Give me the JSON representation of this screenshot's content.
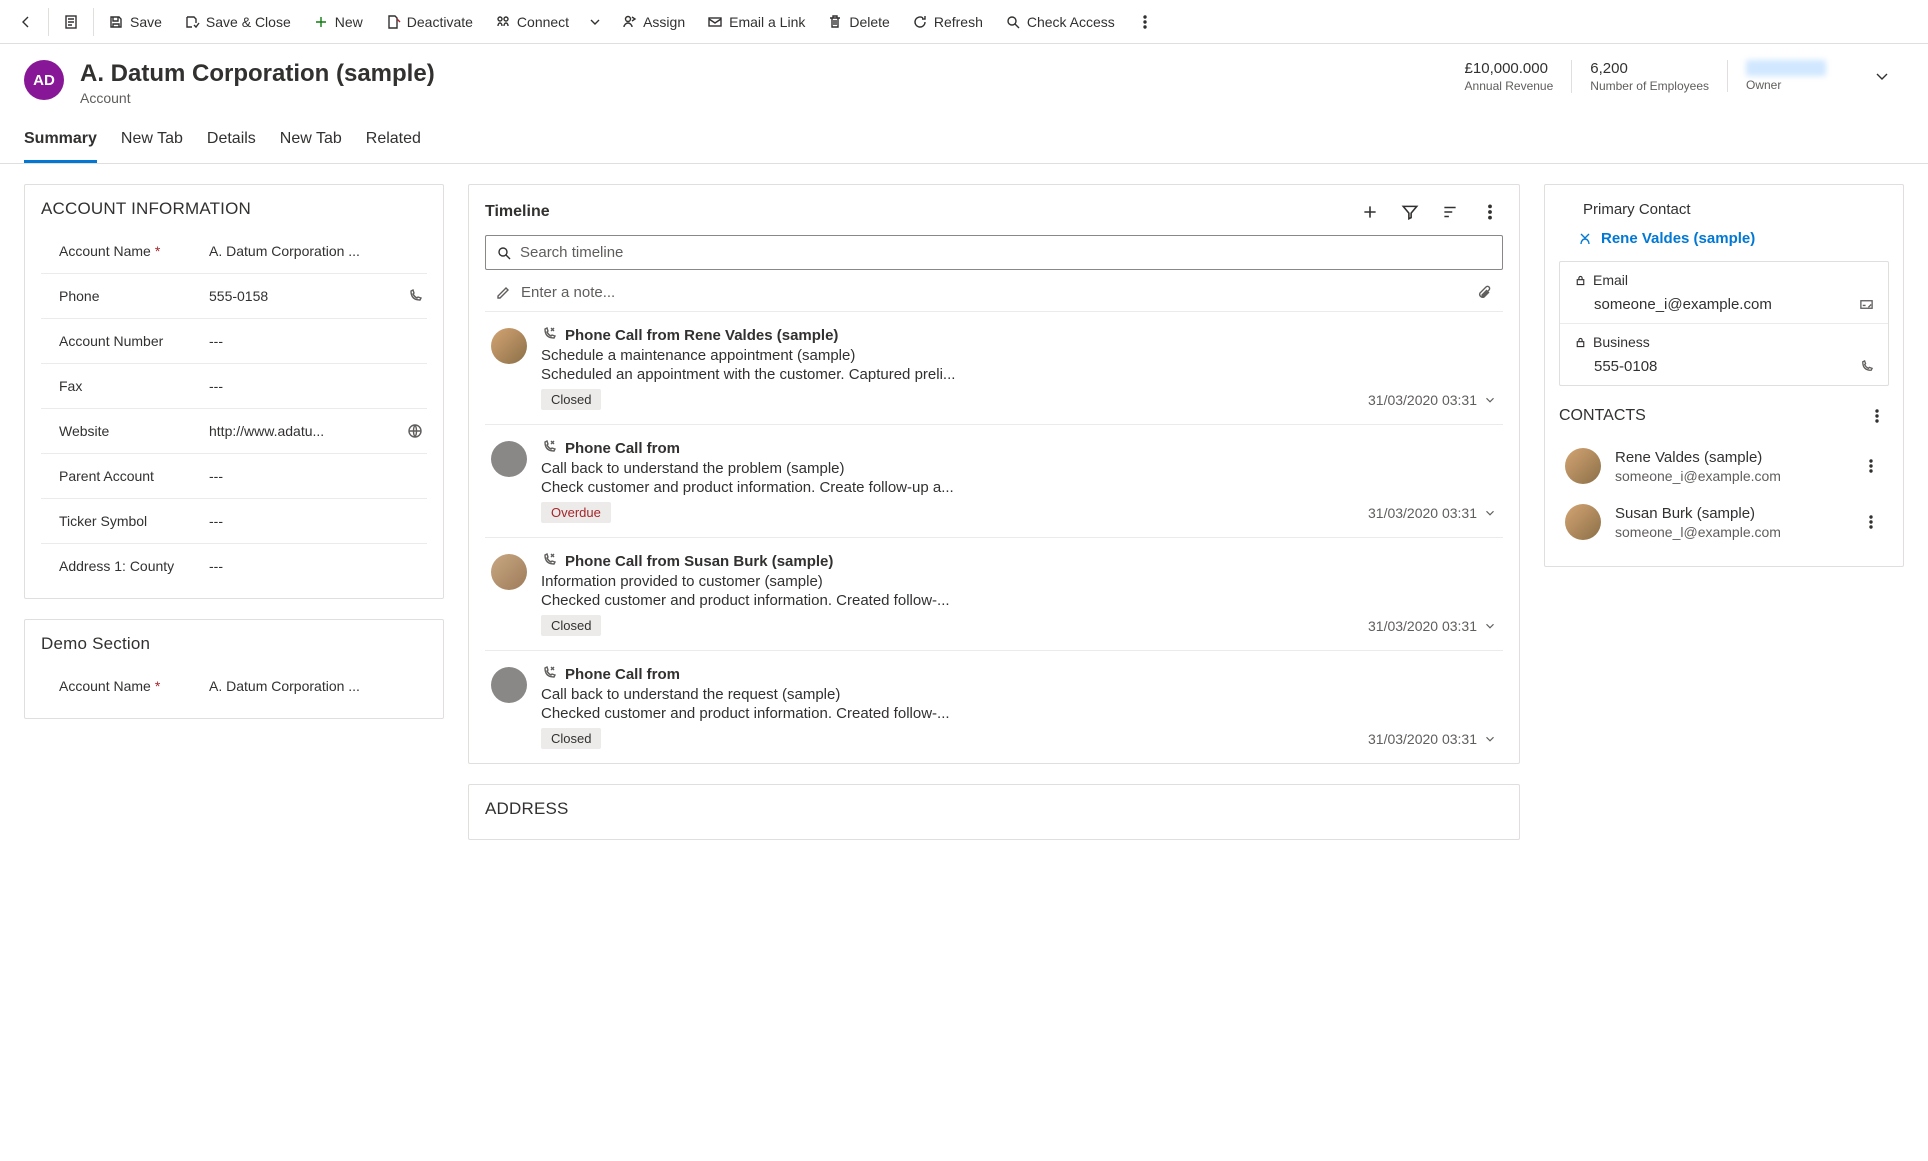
{
  "toolbar": {
    "save": "Save",
    "save_close": "Save & Close",
    "new": "New",
    "deactivate": "Deactivate",
    "connect": "Connect",
    "assign": "Assign",
    "email_link": "Email a Link",
    "delete": "Delete",
    "refresh": "Refresh",
    "check_access": "Check Access"
  },
  "header": {
    "avatar_initials": "AD",
    "title": "A. Datum Corporation (sample)",
    "subtitle": "Account",
    "stats": {
      "annual_revenue_value": "£10,000.000",
      "annual_revenue_label": "Annual Revenue",
      "employees_value": "6,200",
      "employees_label": "Number of Employees",
      "owner_label": "Owner"
    }
  },
  "tabs": [
    "Summary",
    "New Tab",
    "Details",
    "New Tab",
    "Related"
  ],
  "account_info": {
    "section_title": "ACCOUNT INFORMATION",
    "fields": {
      "account_name_label": "Account Name",
      "account_name_value": "A. Datum Corporation ...",
      "phone_label": "Phone",
      "phone_value": "555-0158",
      "account_number_label": "Account Number",
      "account_number_value": "---",
      "fax_label": "Fax",
      "fax_value": "---",
      "website_label": "Website",
      "website_value": "http://www.adatu...",
      "parent_label": "Parent Account",
      "parent_value": "---",
      "ticker_label": "Ticker Symbol",
      "ticker_value": "---",
      "county_label": "Address 1: County",
      "county_value": "---"
    }
  },
  "demo_section": {
    "title": "Demo Section",
    "account_name_label": "Account Name",
    "account_name_value": "A. Datum Corporation ..."
  },
  "address_section_title": "ADDRESS",
  "timeline": {
    "title": "Timeline",
    "search_placeholder": "Search timeline",
    "note_placeholder": "Enter a note...",
    "items": [
      {
        "title": "Phone Call from Rene Valdes (sample)",
        "subject": "Schedule a maintenance appointment (sample)",
        "desc": "Scheduled an appointment with the customer. Captured preli...",
        "badge": "Closed",
        "badge_class": "",
        "date": "31/03/2020 03:31",
        "avatar": "img1"
      },
      {
        "title": "Phone Call from",
        "subject": "Call back to understand the problem (sample)",
        "desc": "Check customer and product information. Create follow-up a...",
        "badge": "Overdue",
        "badge_class": "overdue",
        "date": "31/03/2020 03:31",
        "avatar": ""
      },
      {
        "title": "Phone Call from Susan Burk (sample)",
        "subject": "Information provided to customer (sample)",
        "desc": "Checked customer and product information. Created follow-...",
        "badge": "Closed",
        "badge_class": "",
        "date": "31/03/2020 03:31",
        "avatar": "img2"
      },
      {
        "title": "Phone Call from",
        "subject": "Call back to understand the request (sample)",
        "desc": "Checked customer and product information. Created follow-...",
        "badge": "Closed",
        "badge_class": "",
        "date": "31/03/2020 03:31",
        "avatar": ""
      }
    ]
  },
  "primary_contact": {
    "label": "Primary Contact",
    "name": "Rene Valdes (sample)",
    "email_label": "Email",
    "email_value": "someone_i@example.com",
    "business_label": "Business",
    "business_value": "555-0108"
  },
  "contacts": {
    "title": "CONTACTS",
    "list": [
      {
        "name": "Rene Valdes (sample)",
        "email": "someone_i@example.com"
      },
      {
        "name": "Susan Burk (sample)",
        "email": "someone_l@example.com"
      }
    ]
  }
}
